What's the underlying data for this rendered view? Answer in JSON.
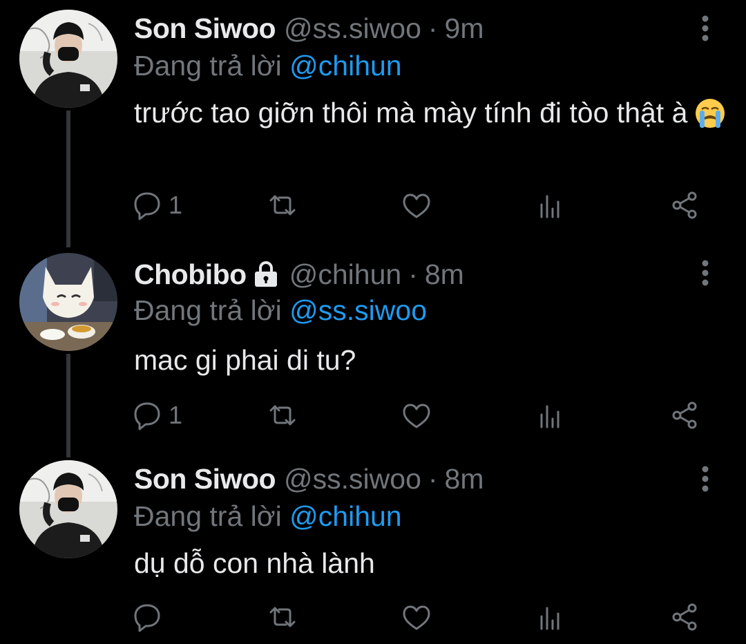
{
  "colors": {
    "background": "#000000",
    "primary_text": "#e7e9ea",
    "secondary_text": "#71767b",
    "accent": "#1d9bf0",
    "thread_line": "#333639"
  },
  "tweets": [
    {
      "display_name": "Son Siwoo",
      "handle": "@ss.siwoo",
      "separator": "·",
      "time": "9m",
      "protected": false,
      "replying_prefix": "Đang trả lời",
      "replying_to": "@chihun",
      "text": "trước tao giỡn thôi mà mày tính đi tòo thật à",
      "emoji": "crying-face",
      "reply_count": "1",
      "icons": [
        "reply-icon",
        "retweet-icon",
        "like-icon",
        "analytics-icon",
        "share-icon",
        "more-icon"
      ]
    },
    {
      "display_name": "Chobibo",
      "handle": "@chihun",
      "separator": "·",
      "time": "8m",
      "protected": true,
      "replying_prefix": "Đang trả lời",
      "replying_to": "@ss.siwoo",
      "text": "mac gi phai di tu?",
      "reply_count": "1",
      "icons": [
        "reply-icon",
        "retweet-icon",
        "like-icon",
        "analytics-icon",
        "share-icon",
        "more-icon",
        "lock-icon"
      ]
    },
    {
      "display_name": "Son Siwoo",
      "handle": "@ss.siwoo",
      "separator": "·",
      "time": "8m",
      "protected": false,
      "replying_prefix": "Đang trả lời",
      "replying_to": "@chihun",
      "text": "dụ dỗ con nhà lành",
      "reply_count": "",
      "icons": [
        "reply-icon",
        "retweet-icon",
        "like-icon",
        "analytics-icon",
        "share-icon",
        "more-icon"
      ]
    }
  ]
}
